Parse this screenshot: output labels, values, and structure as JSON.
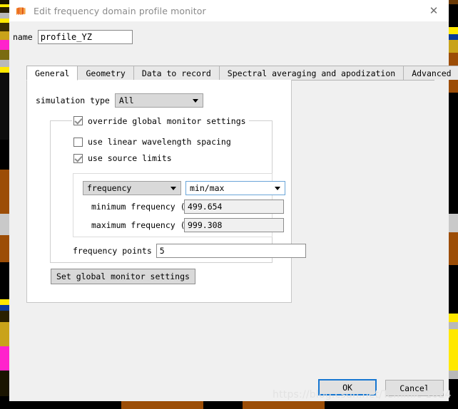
{
  "window": {
    "title": "Edit frequency domain profile monitor",
    "icon": "lumerical-logo-icon",
    "close_label": "✕"
  },
  "name_field": {
    "label": "name",
    "value": "profile_YZ",
    "placeholder": ""
  },
  "tabs": [
    {
      "label": "General",
      "active": true
    },
    {
      "label": "Geometry",
      "active": false
    },
    {
      "label": "Data to record",
      "active": false
    },
    {
      "label": "Spectral averaging and apodization",
      "active": false
    },
    {
      "label": "Advanced",
      "active": false
    }
  ],
  "general": {
    "simulation_type": {
      "label": "simulation type",
      "value": "All"
    },
    "override_group": {
      "checkbox_label": "override global monitor settings",
      "checked": true
    },
    "use_linear_wavelength_spacing": {
      "label": "use linear wavelength spacing",
      "checked": false
    },
    "use_source_limits": {
      "label": "use source limits",
      "checked": true
    },
    "domain_select": {
      "value": "frequency"
    },
    "range_mode_select": {
      "value": "min/max"
    },
    "minimum_frequency": {
      "label": "minimum frequency (THz)",
      "value": "499.654"
    },
    "maximum_frequency": {
      "label": "maximum frequency (THz)",
      "value": "999.308"
    },
    "frequency_points": {
      "label": "frequency points",
      "value": "5"
    },
    "set_global_button": {
      "label": "Set global monitor settings"
    }
  },
  "footer": {
    "ok_label": "OK",
    "cancel_label": "Cancel"
  },
  "watermark": {
    "text": "https://blog.csdn.net/Temmic-1024"
  },
  "colors": {
    "accent_blue": "#1777d1",
    "combo_focus_border": "#6aa5d8",
    "dialog_bg": "#f0f0f0",
    "panel_bg": "#ffffff",
    "title_text": "#8a8a8a"
  }
}
